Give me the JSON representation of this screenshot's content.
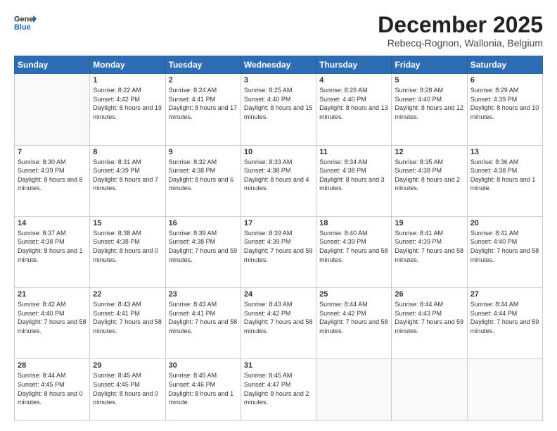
{
  "header": {
    "logo_general": "General",
    "logo_blue": "Blue",
    "month": "December 2025",
    "location": "Rebecq-Rognon, Wallonia, Belgium"
  },
  "weekdays": [
    "Sunday",
    "Monday",
    "Tuesday",
    "Wednesday",
    "Thursday",
    "Friday",
    "Saturday"
  ],
  "weeks": [
    [
      {
        "day": "",
        "sunrise": "",
        "sunset": "",
        "daylight": ""
      },
      {
        "day": "1",
        "sunrise": "Sunrise: 8:22 AM",
        "sunset": "Sunset: 4:42 PM",
        "daylight": "Daylight: 8 hours and 19 minutes."
      },
      {
        "day": "2",
        "sunrise": "Sunrise: 8:24 AM",
        "sunset": "Sunset: 4:41 PM",
        "daylight": "Daylight: 8 hours and 17 minutes."
      },
      {
        "day": "3",
        "sunrise": "Sunrise: 8:25 AM",
        "sunset": "Sunset: 4:40 PM",
        "daylight": "Daylight: 8 hours and 15 minutes."
      },
      {
        "day": "4",
        "sunrise": "Sunrise: 8:26 AM",
        "sunset": "Sunset: 4:40 PM",
        "daylight": "Daylight: 8 hours and 13 minutes."
      },
      {
        "day": "5",
        "sunrise": "Sunrise: 8:28 AM",
        "sunset": "Sunset: 4:40 PM",
        "daylight": "Daylight: 8 hours and 12 minutes."
      },
      {
        "day": "6",
        "sunrise": "Sunrise: 8:29 AM",
        "sunset": "Sunset: 4:39 PM",
        "daylight": "Daylight: 8 hours and 10 minutes."
      }
    ],
    [
      {
        "day": "7",
        "sunrise": "Sunrise: 8:30 AM",
        "sunset": "Sunset: 4:39 PM",
        "daylight": "Daylight: 8 hours and 8 minutes."
      },
      {
        "day": "8",
        "sunrise": "Sunrise: 8:31 AM",
        "sunset": "Sunset: 4:39 PM",
        "daylight": "Daylight: 8 hours and 7 minutes."
      },
      {
        "day": "9",
        "sunrise": "Sunrise: 8:32 AM",
        "sunset": "Sunset: 4:38 PM",
        "daylight": "Daylight: 8 hours and 6 minutes."
      },
      {
        "day": "10",
        "sunrise": "Sunrise: 8:33 AM",
        "sunset": "Sunset: 4:38 PM",
        "daylight": "Daylight: 8 hours and 4 minutes."
      },
      {
        "day": "11",
        "sunrise": "Sunrise: 8:34 AM",
        "sunset": "Sunset: 4:38 PM",
        "daylight": "Daylight: 8 hours and 3 minutes."
      },
      {
        "day": "12",
        "sunrise": "Sunrise: 8:35 AM",
        "sunset": "Sunset: 4:38 PM",
        "daylight": "Daylight: 8 hours and 2 minutes."
      },
      {
        "day": "13",
        "sunrise": "Sunrise: 8:36 AM",
        "sunset": "Sunset: 4:38 PM",
        "daylight": "Daylight: 8 hours and 1 minute."
      }
    ],
    [
      {
        "day": "14",
        "sunrise": "Sunrise: 8:37 AM",
        "sunset": "Sunset: 4:38 PM",
        "daylight": "Daylight: 8 hours and 1 minute."
      },
      {
        "day": "15",
        "sunrise": "Sunrise: 8:38 AM",
        "sunset": "Sunset: 4:38 PM",
        "daylight": "Daylight: 8 hours and 0 minutes."
      },
      {
        "day": "16",
        "sunrise": "Sunrise: 8:39 AM",
        "sunset": "Sunset: 4:38 PM",
        "daylight": "Daylight: 7 hours and 59 minutes."
      },
      {
        "day": "17",
        "sunrise": "Sunrise: 8:39 AM",
        "sunset": "Sunset: 4:39 PM",
        "daylight": "Daylight: 7 hours and 59 minutes."
      },
      {
        "day": "18",
        "sunrise": "Sunrise: 8:40 AM",
        "sunset": "Sunset: 4:39 PM",
        "daylight": "Daylight: 7 hours and 58 minutes."
      },
      {
        "day": "19",
        "sunrise": "Sunrise: 8:41 AM",
        "sunset": "Sunset: 4:39 PM",
        "daylight": "Daylight: 7 hours and 58 minutes."
      },
      {
        "day": "20",
        "sunrise": "Sunrise: 8:41 AM",
        "sunset": "Sunset: 4:40 PM",
        "daylight": "Daylight: 7 hours and 58 minutes."
      }
    ],
    [
      {
        "day": "21",
        "sunrise": "Sunrise: 8:42 AM",
        "sunset": "Sunset: 4:40 PM",
        "daylight": "Daylight: 7 hours and 58 minutes."
      },
      {
        "day": "22",
        "sunrise": "Sunrise: 8:43 AM",
        "sunset": "Sunset: 4:41 PM",
        "daylight": "Daylight: 7 hours and 58 minutes."
      },
      {
        "day": "23",
        "sunrise": "Sunrise: 8:43 AM",
        "sunset": "Sunset: 4:41 PM",
        "daylight": "Daylight: 7 hours and 58 minutes."
      },
      {
        "day": "24",
        "sunrise": "Sunrise: 8:43 AM",
        "sunset": "Sunset: 4:42 PM",
        "daylight": "Daylight: 7 hours and 58 minutes."
      },
      {
        "day": "25",
        "sunrise": "Sunrise: 8:44 AM",
        "sunset": "Sunset: 4:42 PM",
        "daylight": "Daylight: 7 hours and 58 minutes."
      },
      {
        "day": "26",
        "sunrise": "Sunrise: 8:44 AM",
        "sunset": "Sunset: 4:43 PM",
        "daylight": "Daylight: 7 hours and 59 minutes."
      },
      {
        "day": "27",
        "sunrise": "Sunrise: 8:44 AM",
        "sunset": "Sunset: 4:44 PM",
        "daylight": "Daylight: 7 hours and 59 minutes."
      }
    ],
    [
      {
        "day": "28",
        "sunrise": "Sunrise: 8:44 AM",
        "sunset": "Sunset: 4:45 PM",
        "daylight": "Daylight: 8 hours and 0 minutes."
      },
      {
        "day": "29",
        "sunrise": "Sunrise: 8:45 AM",
        "sunset": "Sunset: 4:45 PM",
        "daylight": "Daylight: 8 hours and 0 minutes."
      },
      {
        "day": "30",
        "sunrise": "Sunrise: 8:45 AM",
        "sunset": "Sunset: 4:46 PM",
        "daylight": "Daylight: 8 hours and 1 minute."
      },
      {
        "day": "31",
        "sunrise": "Sunrise: 8:45 AM",
        "sunset": "Sunset: 4:47 PM",
        "daylight": "Daylight: 8 hours and 2 minutes."
      },
      {
        "day": "",
        "sunrise": "",
        "sunset": "",
        "daylight": ""
      },
      {
        "day": "",
        "sunrise": "",
        "sunset": "",
        "daylight": ""
      },
      {
        "day": "",
        "sunrise": "",
        "sunset": "",
        "daylight": ""
      }
    ]
  ]
}
